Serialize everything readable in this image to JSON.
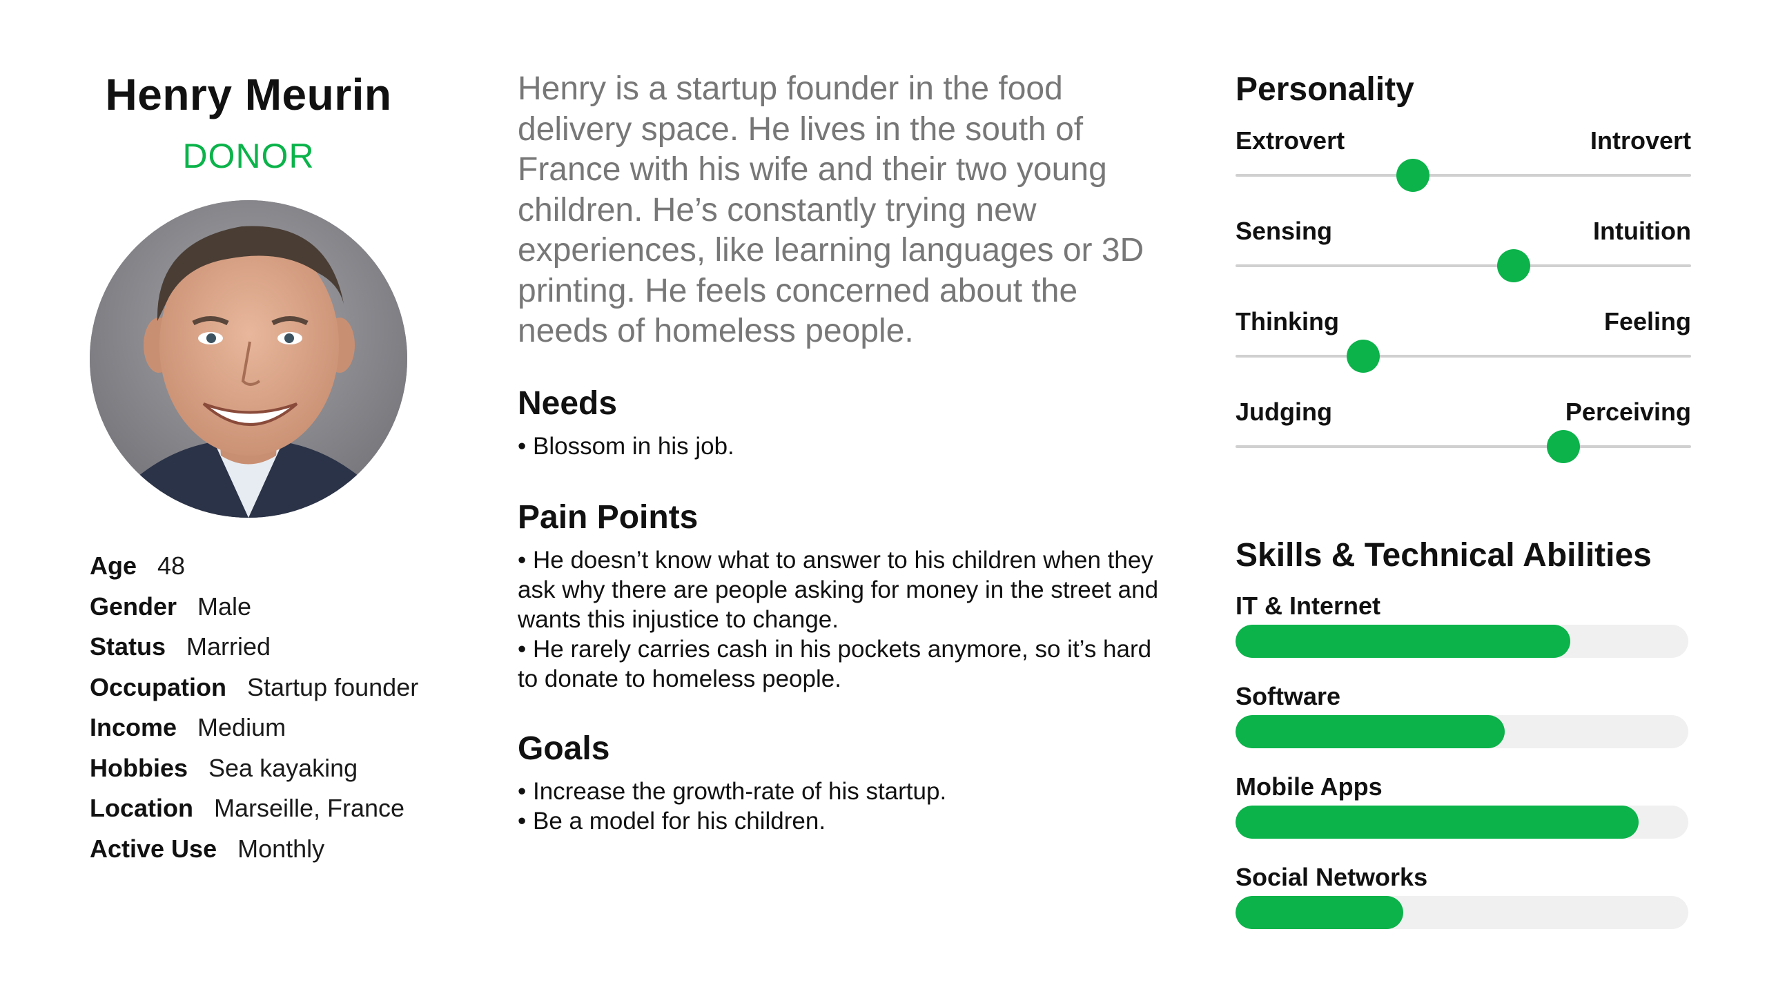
{
  "profile": {
    "name": "Henry Meurin",
    "role": "DONOR",
    "facts": [
      {
        "label": "Age",
        "value": "48"
      },
      {
        "label": "Gender",
        "value": "Male"
      },
      {
        "label": "Status",
        "value": "Married"
      },
      {
        "label": "Occupation",
        "value": "Startup founder"
      },
      {
        "label": "Income",
        "value": "Medium"
      },
      {
        "label": "Hobbies",
        "value": "Sea kayaking"
      },
      {
        "label": "Location",
        "value": "Marseille, France"
      },
      {
        "label": "Active Use",
        "value": "Monthly"
      }
    ]
  },
  "bio": "Henry is a startup founder in the food delivery space. He lives in the south of France with his wife and their two young children. He’s constantly trying new experiences, like learning languages or 3D printing. He feels concerned about the needs of homeless people.",
  "needs": {
    "title": "Needs",
    "items": [
      "Blossom in his job."
    ]
  },
  "pain_points": {
    "title": "Pain Points",
    "items": [
      "He doesn’t know what to answer to his children when they ask why there are people asking for money in the street and wants this injustice to change.",
      "He rarely carries cash in his pockets anymore, so it’s hard to donate to homeless people."
    ]
  },
  "goals": {
    "title": "Goals",
    "items": [
      "Increase the growth-rate of his startup.",
      "Be a model for his children."
    ]
  },
  "personality": {
    "title": "Personality",
    "traits": [
      {
        "left": "Extrovert",
        "right": "Introvert",
        "value": 0.39
      },
      {
        "left": "Sensing",
        "right": "Intuition",
        "value": 0.61
      },
      {
        "left": "Thinking",
        "right": "Feeling",
        "value": 0.28
      },
      {
        "left": "Judging",
        "right": "Perceiving",
        "value": 0.72
      }
    ]
  },
  "skills": {
    "title": "Skills & Technical Abilities",
    "items": [
      {
        "label": "IT & Internet",
        "value": 0.74
      },
      {
        "label": "Software",
        "value": 0.595
      },
      {
        "label": "Mobile Apps",
        "value": 0.89
      },
      {
        "label": "Social Networks",
        "value": 0.37
      }
    ]
  },
  "colors": {
    "accent": "#0bb34a",
    "track": "#d0d0d0",
    "bar_bg": "#f0f0f0",
    "bio_text": "#777777"
  }
}
